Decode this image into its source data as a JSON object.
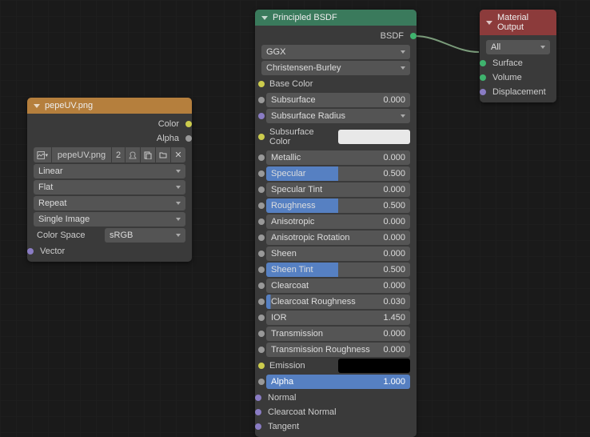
{
  "texture_node": {
    "title": "pepeUV.png",
    "out_color": "Color",
    "out_alpha": "Alpha",
    "image_name": "pepeUV.png",
    "users": "2",
    "interp": "Linear",
    "projection": "Flat",
    "extension": "Repeat",
    "source": "Single Image",
    "colorspace_label": "Color Space",
    "colorspace_value": "sRGB",
    "in_vector": "Vector"
  },
  "bsdf": {
    "title": "Principled BSDF",
    "out_bsdf": "BSDF",
    "distribution": "GGX",
    "sss_method": "Christensen-Burley",
    "base_color_label": "Base Color",
    "base_color": "#4fd14f",
    "subsurface": {
      "label": "Subsurface",
      "value": "0.000"
    },
    "subsurface_radius": "Subsurface Radius",
    "subsurface_color_label": "Subsurface Color",
    "subsurface_color": "#e8e8e8",
    "metallic": {
      "label": "Metallic",
      "value": "0.000"
    },
    "specular": {
      "label": "Specular",
      "value": "0.500"
    },
    "specular_tint": {
      "label": "Specular Tint",
      "value": "0.000"
    },
    "roughness": {
      "label": "Roughness",
      "value": "0.500"
    },
    "anisotropic": {
      "label": "Anisotropic",
      "value": "0.000"
    },
    "anisotropic_rotation": {
      "label": "Anisotropic Rotation",
      "value": "0.000"
    },
    "sheen": {
      "label": "Sheen",
      "value": "0.000"
    },
    "sheen_tint": {
      "label": "Sheen Tint",
      "value": "0.500"
    },
    "clearcoat": {
      "label": "Clearcoat",
      "value": "0.000"
    },
    "clearcoat_roughness": {
      "label": "Clearcoat Roughness",
      "value": "0.030"
    },
    "ior": {
      "label": "IOR",
      "value": "1.450"
    },
    "transmission": {
      "label": "Transmission",
      "value": "0.000"
    },
    "transmission_roughness": {
      "label": "Transmission Roughness",
      "value": "0.000"
    },
    "emission_label": "Emission",
    "emission_color": "#000000",
    "alpha": {
      "label": "Alpha",
      "value": "1.000"
    },
    "normal": "Normal",
    "clearcoat_normal": "Clearcoat Normal",
    "tangent": "Tangent"
  },
  "output": {
    "title": "Material Output",
    "target": "All",
    "surface": "Surface",
    "volume": "Volume",
    "displacement": "Displacement"
  }
}
